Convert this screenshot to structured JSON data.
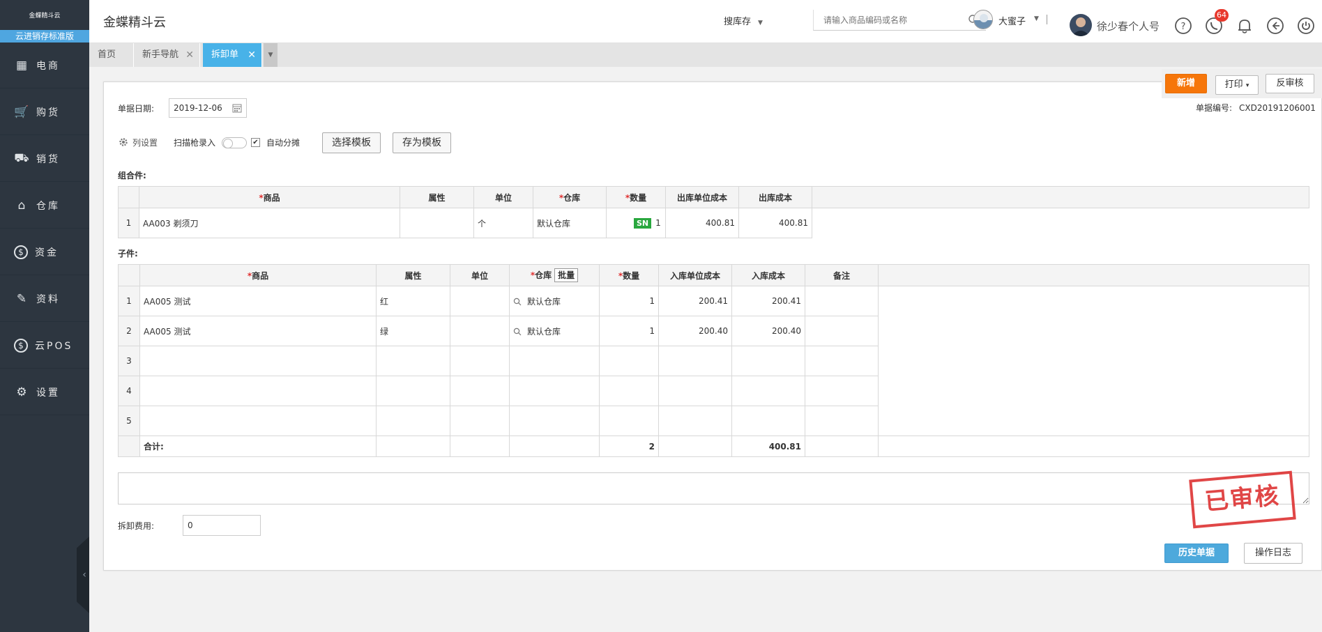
{
  "sidebar": {
    "logo_text": "金蝶精斗云",
    "edition": "云进销存标准版",
    "items": [
      {
        "label": "电商",
        "icon": "store-icon"
      },
      {
        "label": "购货",
        "icon": "cart-icon"
      },
      {
        "label": "销货",
        "icon": "trolley-icon"
      },
      {
        "label": "仓库",
        "icon": "warehouse-icon"
      },
      {
        "label": "资金",
        "icon": "dollar-icon"
      },
      {
        "label": "资料",
        "icon": "pencil-icon"
      },
      {
        "label": "云POS",
        "icon": "dollar-icon"
      },
      {
        "label": "设置",
        "icon": "gear-icon"
      }
    ],
    "collapse_glyph": "‹"
  },
  "header": {
    "title": "金蝶精斗云",
    "search_type": "搜库存",
    "search_placeholder": "请输入商品编码或名称",
    "store_name": "大蜜子",
    "user_name": "徐少春个人号",
    "notification_count": "64"
  },
  "tabs": [
    {
      "label": "首页",
      "closable": false,
      "active": false
    },
    {
      "label": "新手导航",
      "closable": true,
      "active": false
    },
    {
      "label": "拆卸单",
      "closable": true,
      "active": true
    }
  ],
  "toolbar": {
    "new_label": "新增",
    "print_label": "打印",
    "print_caret": "▾",
    "unaudit_label": "反审核"
  },
  "form": {
    "date_label": "单据日期:",
    "date_value": "2019-12-06",
    "bill_no_label": "单据编号:",
    "bill_no_value": "CXD20191206001",
    "column_settings": "列设置",
    "scan_label": "扫描枪录入",
    "auto_split_label": "自动分摊",
    "auto_split_checked": "✔",
    "choose_template": "选择模板",
    "save_template": "存为模板",
    "assembly_label": "组合件:",
    "components_label": "子件:",
    "fee_label": "拆卸费用:",
    "fee_value": "0"
  },
  "assembly_table": {
    "headers": [
      "",
      "商品",
      "属性",
      "单位",
      "仓库",
      "数量",
      "出库单位成本",
      "出库成本"
    ],
    "required": [
      "商品",
      "仓库",
      "数量"
    ],
    "rows": [
      {
        "idx": "1",
        "product": "AA003 剃须刀",
        "attr": "",
        "unit": "个",
        "warehouse": "默认仓库",
        "sn": "SN",
        "qty": "1",
        "unit_cost": "400.81",
        "cost": "400.81"
      }
    ]
  },
  "component_table": {
    "headers": [
      "",
      "商品",
      "属性",
      "单位",
      "仓库",
      "数量",
      "入库单位成本",
      "入库成本",
      "备注"
    ],
    "batch_label": "批量",
    "rows": [
      {
        "idx": "1",
        "product": "AA005 测试",
        "attr": "红",
        "unit": "",
        "warehouse": "默认仓库",
        "qty": "1",
        "unit_cost": "200.41",
        "cost": "200.41",
        "remark": ""
      },
      {
        "idx": "2",
        "product": "AA005 测试",
        "attr": "绿",
        "unit": "",
        "warehouse": "默认仓库",
        "qty": "1",
        "unit_cost": "200.40",
        "cost": "200.40",
        "remark": ""
      },
      {
        "idx": "3",
        "product": "",
        "attr": "",
        "unit": "",
        "warehouse": "",
        "qty": "",
        "unit_cost": "",
        "cost": "",
        "remark": ""
      },
      {
        "idx": "4",
        "product": "",
        "attr": "",
        "unit": "",
        "warehouse": "",
        "qty": "",
        "unit_cost": "",
        "cost": "",
        "remark": ""
      },
      {
        "idx": "5",
        "product": "",
        "attr": "",
        "unit": "",
        "warehouse": "",
        "qty": "",
        "unit_cost": "",
        "cost": "",
        "remark": ""
      }
    ],
    "total_label": "合计:",
    "total_qty": "2",
    "total_cost": "400.81"
  },
  "stamp_text": "已审核",
  "footer": {
    "history_label": "历史单据",
    "log_label": "操作日志"
  },
  "colors": {
    "sidebar_bg": "#2d3640",
    "accent_blue": "#48b2e8",
    "new_orange": "#f6760a",
    "stamp_red": "#d33333",
    "sn_green": "#29a73e"
  }
}
